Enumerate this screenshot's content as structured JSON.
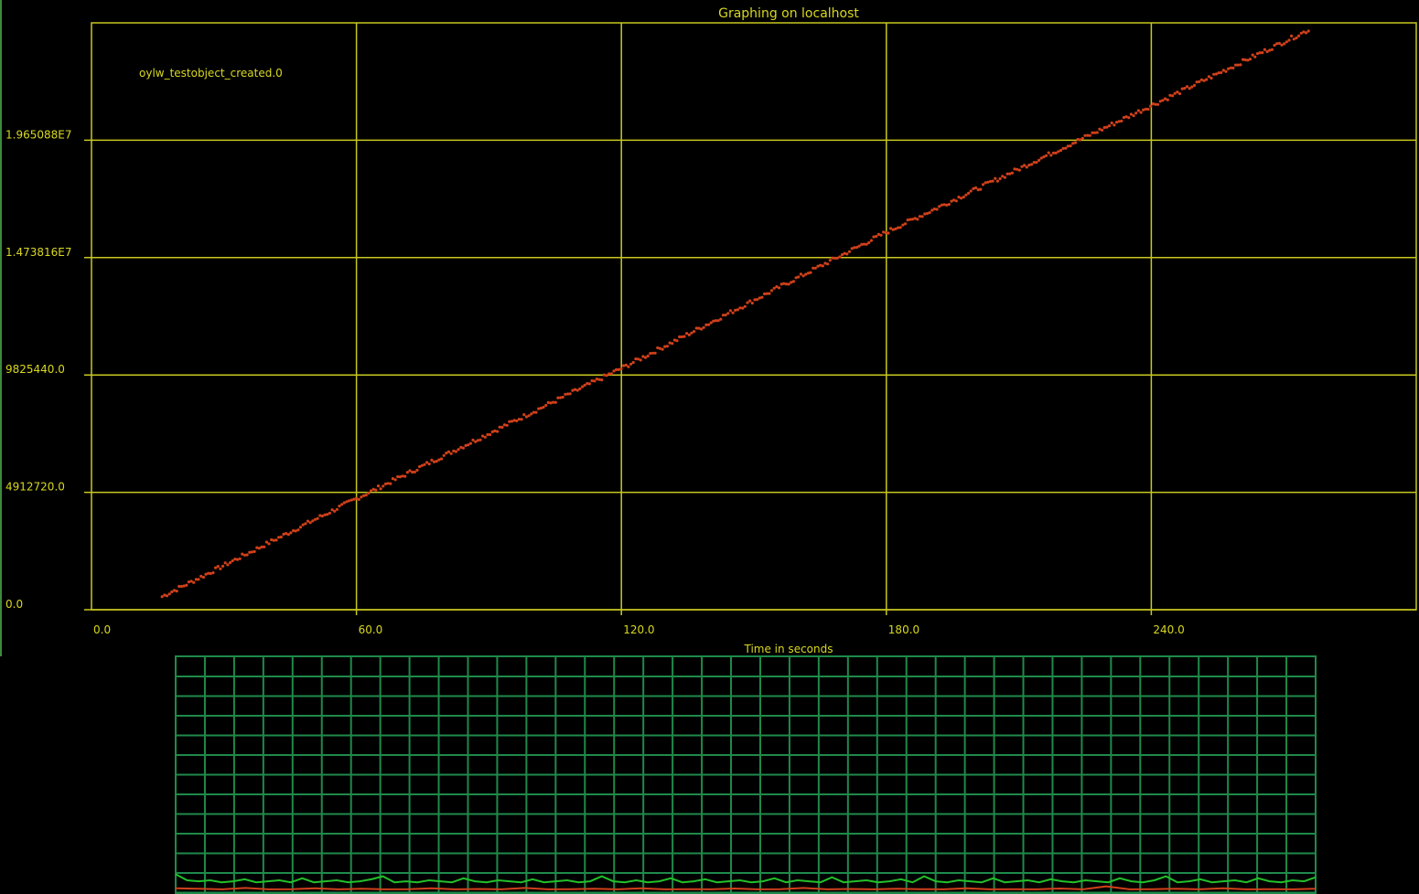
{
  "colors": {
    "background": "#000000",
    "grid": "#c8c820",
    "text": "#d8d820",
    "series": "#d0401a",
    "monitor_grid": "#1f8a4a",
    "monitor_line": "#22c02a",
    "monitor_line2": "#d0401a",
    "left_edge": "#3d8a3d"
  },
  "chart_data": [
    {
      "type": "scatter",
      "title": "Graphing on localhost",
      "xlabel": "Time in seconds",
      "ylabel": "",
      "xlim": [
        0,
        300
      ],
      "ylim": [
        0,
        24563600
      ],
      "x_ticks": [
        0,
        60,
        120,
        180,
        240
      ],
      "x_tick_labels": [
        "0.0",
        "60.0",
        "120.0",
        "180.0",
        "240.0"
      ],
      "y_ticks": [
        0,
        4912720,
        9825440,
        14738160,
        19650880
      ],
      "y_tick_labels": [
        "0.0",
        "4912720.0",
        "9825440.0",
        "1.473816E7",
        "1.965088E7"
      ],
      "grid": true,
      "legend_position": "top-left",
      "series": [
        {
          "name": "oylw_testobject_created.0",
          "x_range": [
            16,
            276
          ],
          "points": [
            [
              16,
              550000
            ],
            [
              60,
              4650000
            ],
            [
              120,
              10100000
            ],
            [
              180,
              15800000
            ],
            [
              240,
              21100000
            ],
            [
              276,
              24300000
            ]
          ]
        }
      ]
    },
    {
      "type": "line",
      "title": "",
      "xlabel": "",
      "ylabel": "",
      "grid": true,
      "series": [
        {
          "values": [
            0.8,
            0.5,
            0.45,
            0.5,
            0.4,
            0.45,
            0.55,
            0.4,
            0.45,
            0.5,
            0.4,
            0.6,
            0.4,
            0.45,
            0.5,
            0.4,
            0.45,
            0.55,
            0.7,
            0.4,
            0.45,
            0.4,
            0.5,
            0.45,
            0.4,
            0.6,
            0.45,
            0.4,
            0.5,
            0.45,
            0.4,
            0.55,
            0.4,
            0.45,
            0.5,
            0.4,
            0.45,
            0.7,
            0.45,
            0.4,
            0.5,
            0.4,
            0.45,
            0.6,
            0.4,
            0.45,
            0.55,
            0.4,
            0.45,
            0.5,
            0.4,
            0.45,
            0.6,
            0.4,
            0.5,
            0.45,
            0.4,
            0.65,
            0.4,
            0.45,
            0.5,
            0.4,
            0.45,
            0.55,
            0.4,
            0.7,
            0.45,
            0.4,
            0.5,
            0.45,
            0.4,
            0.6,
            0.4,
            0.45,
            0.5,
            0.4,
            0.55,
            0.45,
            0.4,
            0.5,
            0.45,
            0.4,
            0.6,
            0.45,
            0.4,
            0.5,
            0.7,
            0.4,
            0.45,
            0.55,
            0.4,
            0.45,
            0.5,
            0.4,
            0.6,
            0.45,
            0.4,
            0.5,
            0.45,
            0.65
          ]
        },
        {
          "values": [
            0.1,
            0.08,
            0.05,
            0.12,
            0.05,
            0.06,
            0.1,
            0.05,
            0.08,
            0.05,
            0.06,
            0.1,
            0.05,
            0.07,
            0.05,
            0.12,
            0.05,
            0.06,
            0.08,
            0.05,
            0.1,
            0.05,
            0.06,
            0.05,
            0.09,
            0.05,
            0.06,
            0.12,
            0.05,
            0.07,
            0.05,
            0.08,
            0.06,
            0.05,
            0.1,
            0.05,
            0.06,
            0.05,
            0.09,
            0.05,
            0.2,
            0.05,
            0.06,
            0.08,
            0.05,
            0.1,
            0.05,
            0.06,
            0.05,
            0.08
          ]
        }
      ]
    }
  ]
}
